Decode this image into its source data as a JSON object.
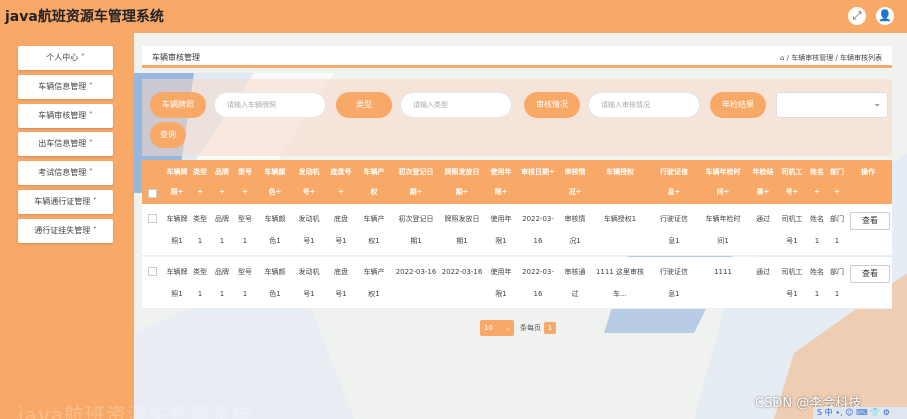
{
  "app": {
    "title": "java航班资源车管理系统"
  },
  "topbar": {
    "expand_icon": "⤢",
    "user_icon": "👤"
  },
  "sidebar": {
    "items": [
      {
        "label": "个人中心 ˅"
      },
      {
        "label": "车辆信息管理 ˅"
      },
      {
        "label": "车辆审核管理 ˅"
      },
      {
        "label": "出车信息管理 ˅"
      },
      {
        "label": "考试信息管理 ˅"
      },
      {
        "label": "车辆通行证管理 ˅"
      },
      {
        "label": "通行证挂失管理 ˅"
      }
    ]
  },
  "header": {
    "title": "车辆审核管理",
    "breadcrumb": "⌂ / 车辆审核管理 / 车辆审核列表"
  },
  "filters": {
    "plate_label": "车辆牌照",
    "plate_placeholder": "请输入车辆牌照",
    "type_label": "类型",
    "type_placeholder": "请输入类型",
    "status_label": "审核情况",
    "status_placeholder": "请输入审核情况",
    "result_label": "年检结果",
    "result_value": "",
    "search_label": "查询"
  },
  "table": {
    "headers": [
      [
        "车辆牌",
        "照÷"
      ],
      [
        "类型",
        "÷"
      ],
      [
        "品牌",
        "÷"
      ],
      [
        "型号",
        "÷"
      ],
      [
        "车辆颜",
        "色÷"
      ],
      [
        "发动机",
        "号÷"
      ],
      [
        "底盘号",
        "÷"
      ],
      [
        "车辆产",
        "权"
      ],
      [
        "初次登记日",
        "期÷"
      ],
      [
        "牌照发放日",
        "期÷"
      ],
      [
        "使用年",
        "限÷"
      ],
      [
        "",
        "审核日期÷"
      ],
      [
        "审核情",
        "况÷"
      ],
      [
        "",
        "车辆授权"
      ],
      [
        "行驶证信",
        "息÷"
      ],
      [
        "车辆年检时",
        "间÷"
      ],
      [
        "年检结",
        "果÷"
      ],
      [
        "司机工",
        "号÷"
      ],
      [
        "姓名",
        "÷"
      ],
      [
        "部门",
        "÷"
      ],
      [
        "",
        "操作"
      ]
    ],
    "rows": [
      {
        "cells": [
          [
            "车辆牌",
            "照1"
          ],
          [
            "类型",
            "1"
          ],
          [
            "品牌",
            "1"
          ],
          [
            "型号",
            "1"
          ],
          [
            "车辆颜",
            "色1"
          ],
          [
            "发动机",
            "号1"
          ],
          [
            "底盘",
            "号1"
          ],
          [
            "车辆产",
            "权1"
          ],
          [
            "初次登记日",
            "期1"
          ],
          [
            "牌照发放日",
            "期1"
          ],
          [
            "使用年",
            "限1"
          ],
          [
            "2022-03-",
            "16"
          ],
          [
            "审核情",
            "况1"
          ],
          [
            "车辆授权1",
            ""
          ],
          [
            "行驶证信",
            "息1"
          ],
          [
            "车辆年检时",
            "间1"
          ],
          [
            "通过",
            ""
          ],
          [
            "司机工",
            "号1"
          ],
          [
            "姓名",
            "1"
          ],
          [
            "部门",
            "1"
          ]
        ],
        "action": "查看"
      },
      {
        "cells": [
          [
            "车辆牌",
            "照1"
          ],
          [
            "类型",
            "1"
          ],
          [
            "品牌",
            "1"
          ],
          [
            "型号",
            "1"
          ],
          [
            "车辆颜",
            "色1"
          ],
          [
            "发动机",
            "号1"
          ],
          [
            "底盘",
            "号1"
          ],
          [
            "车辆产",
            "权1"
          ],
          [
            "2022-03-16",
            ""
          ],
          [
            "2022-03-16",
            ""
          ],
          [
            "使用年",
            "限1"
          ],
          [
            "2022-03-",
            "16"
          ],
          [
            "审核通",
            "过"
          ],
          [
            "1111 这里审核",
            "车..."
          ],
          [
            "行驶证信",
            "息1"
          ],
          [
            "1111",
            ""
          ],
          [
            "通过",
            ""
          ],
          [
            "司机工",
            "号1"
          ],
          [
            "姓名",
            "1"
          ],
          [
            "部门",
            "1"
          ]
        ],
        "action": "查看"
      }
    ]
  },
  "pagination": {
    "page_size": "10",
    "per_page_label": "条每页",
    "current_page": "1"
  },
  "overlay": {
    "watermark": "java航班资源车管理系统",
    "csdn": "CSDN @李会科技",
    "ime": "S 中 ∙, ☺ ⌨ 👕 ⚙"
  },
  "colors": {
    "accent": "#f8a867",
    "panel": "#ffffff",
    "blue_deco": "#5b8fd6"
  }
}
